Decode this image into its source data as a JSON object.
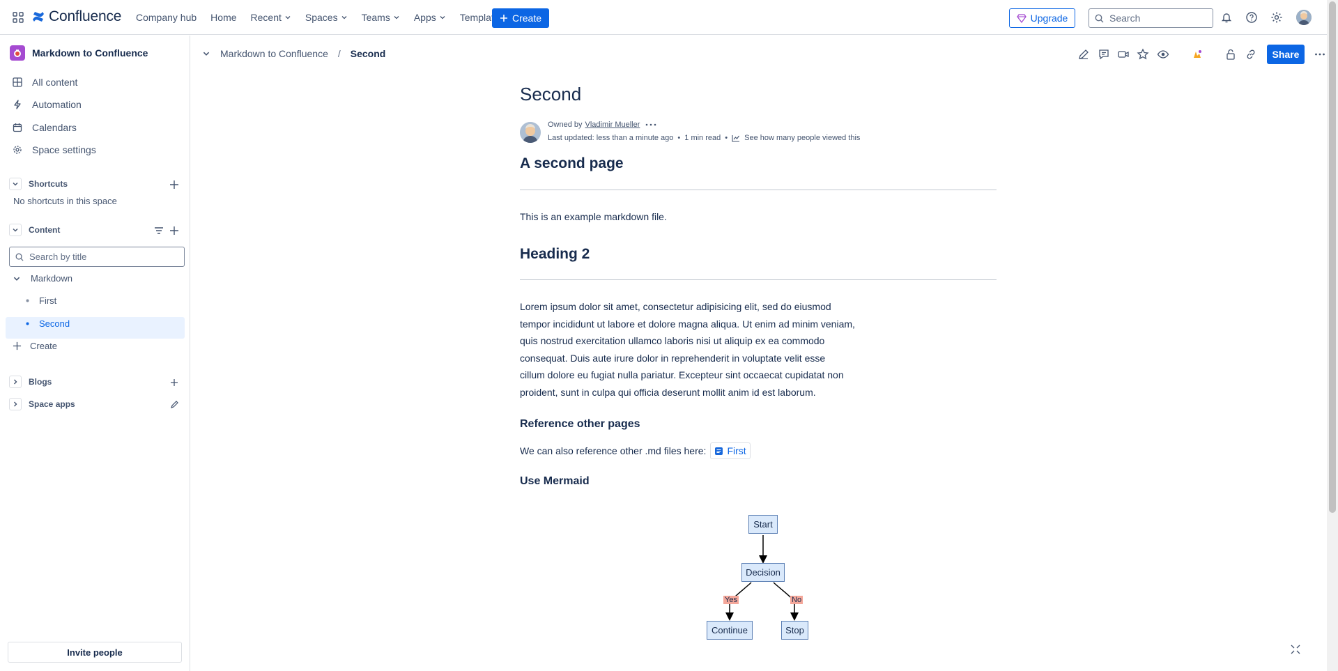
{
  "topnav": {
    "app_name": "Confluence",
    "links": [
      {
        "label": "Company hub",
        "dropdown": false
      },
      {
        "label": "Home",
        "dropdown": false
      },
      {
        "label": "Recent",
        "dropdown": true
      },
      {
        "label": "Spaces",
        "dropdown": true
      },
      {
        "label": "Teams",
        "dropdown": true
      },
      {
        "label": "Apps",
        "dropdown": true
      },
      {
        "label": "Templates",
        "dropdown": false
      }
    ],
    "create_label": "Create",
    "upgrade_label": "Upgrade",
    "search_placeholder": "Search"
  },
  "sidebar": {
    "space_name": "Markdown to Confluence",
    "items": [
      {
        "label": "All content",
        "icon": "grid-icon"
      },
      {
        "label": "Automation",
        "icon": "lightning-icon"
      },
      {
        "label": "Calendars",
        "icon": "calendar-icon"
      },
      {
        "label": "Space settings",
        "icon": "gear-icon"
      }
    ],
    "shortcuts_label": "Shortcuts",
    "no_shortcuts": "No shortcuts in this space",
    "content_label": "Content",
    "search_placeholder": "Search by title",
    "tree": {
      "parent": "Markdown",
      "children": [
        "First",
        "Second"
      ],
      "selected": "Second",
      "create_label": "Create"
    },
    "blogs_label": "Blogs",
    "space_apps_label": "Space apps",
    "invite_label": "Invite people"
  },
  "breadcrumb": {
    "space": "Markdown to Confluence",
    "separator": "/",
    "current": "Second"
  },
  "toolbar": {
    "share_label": "Share"
  },
  "page": {
    "title": "Second",
    "owned_prefix": "Owned by",
    "owner": "Vladimir Mueller",
    "last_updated": "Last updated: less than a minute ago",
    "bullet": "•",
    "read_time": "1 min read",
    "views_link": "See how many people viewed this",
    "h1_a": "A second page",
    "p1": "This is an example markdown file.",
    "h1_b": "Heading 2",
    "lorem_lines": [
      "Lorem ipsum dolor sit amet, consectetur adipisicing elit, sed do eiusmod",
      "tempor incididunt ut labore et dolore magna aliqua. Ut enim ad minim veniam,",
      "quis nostrud exercitation ullamco laboris nisi ut aliquip ex ea commodo",
      "consequat. Duis aute irure dolor in reprehenderit in voluptate velit esse",
      "cillum dolore eu fugiat nulla pariatur. Excepteur sint occaecat cupidatat non",
      "proident, sunt in culpa qui officia deserunt mollit anim id est laborum."
    ],
    "h3_a": "Reference other pages",
    "ref_text": "We can also reference other .md files here:",
    "ref_link": "First",
    "h3_b": "Use Mermaid"
  },
  "mermaid": {
    "nodes": {
      "start": "Start",
      "decision": "Decision",
      "continue": "Continue",
      "stop": "Stop"
    },
    "edges": {
      "yes": "Yes",
      "no": "No"
    }
  },
  "colors": {
    "brand_blue": "#0c66e4",
    "space_icon": "#a54bd1",
    "selected_bg": "#e9f2ff",
    "node_fill": "#dae9fb",
    "edge_label": "#f4a79a"
  }
}
